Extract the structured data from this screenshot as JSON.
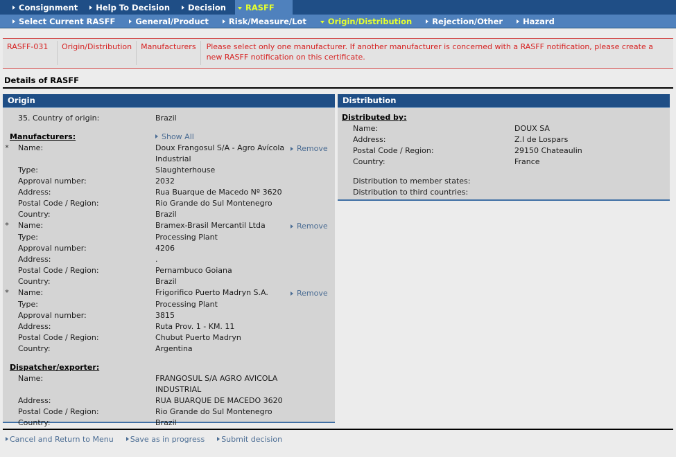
{
  "nav": {
    "primary": [
      {
        "label": "Consignment",
        "icon": "chevron-right-icon",
        "active": false
      },
      {
        "label": "Help To Decision",
        "icon": "chevron-right-icon",
        "active": false
      },
      {
        "label": "Decision",
        "icon": "chevron-right-icon",
        "active": false
      },
      {
        "label": "RASFF",
        "icon": "chevron-down-icon",
        "active": true
      }
    ],
    "secondary": [
      {
        "label": "Select Current RASFF",
        "icon": "chevron-right-icon",
        "active": false
      },
      {
        "label": "General/Product",
        "icon": "chevron-right-icon",
        "active": false
      },
      {
        "label": "Risk/Measure/Lot",
        "icon": "chevron-right-icon",
        "active": false
      },
      {
        "label": "Origin/Distribution",
        "icon": "chevron-down-icon",
        "active": true
      },
      {
        "label": "Rejection/Other",
        "icon": "chevron-right-icon",
        "active": false
      },
      {
        "label": "Hazard",
        "icon": "chevron-right-icon",
        "active": false
      }
    ]
  },
  "message": {
    "code": "RASFF-031",
    "section": "Origin/Distribution",
    "field": "Manufacturers",
    "text": "Please select only one manufacturer. If another manufacturer is concerned with a RASFF notification, please create a new RASFF notification on this certificate.",
    "color": "#d62020"
  },
  "page": {
    "details_title": "Details of RASFF"
  },
  "origin": {
    "panel_title": "Origin",
    "country_of_origin_label": "35. Country of origin:",
    "country_of_origin_value": "Brazil",
    "manufacturers_label": "Manufacturers:",
    "show_all_label": "Show All",
    "remove_label": "Remove",
    "required_marker": "*",
    "field_labels": {
      "name": "Name:",
      "type": "Type:",
      "approval_number": "Approval number:",
      "address": "Address:",
      "postal_code_region": "Postal Code / Region:",
      "country": "Country:"
    },
    "manufacturers": [
      {
        "name": "Doux Frangosul S/A - Agro Avícola Industrial",
        "type": "Slaughterhouse",
        "approval_number": "2032",
        "address": "Rua Buarque de Macedo Nº 3620",
        "postal_code_region": "Rio Grande do Sul Montenegro",
        "country": "Brazil"
      },
      {
        "name": "Bramex-Brasil Mercantil Ltda",
        "type": "Processing Plant",
        "approval_number": "4206",
        "address": ".",
        "postal_code_region": "Pernambuco Goiana",
        "country": "Brazil"
      },
      {
        "name": "Frigorifico Puerto Madryn S.A.",
        "type": "Processing Plant",
        "approval_number": "3815",
        "address": "Ruta Prov. 1 - KM. 11",
        "postal_code_region": "Chubut Puerto Madryn",
        "country": "Argentina"
      }
    ],
    "dispatcher": {
      "heading": "Dispatcher/exporter:",
      "name": "FRANGOSUL S/A AGRO AVICOLA INDUSTRIAL",
      "address": "RUA BUARQUE DE MACEDO 3620",
      "postal_code_region": "Rio Grande do Sul Montenegro",
      "country": "Brazil"
    }
  },
  "distribution": {
    "panel_title": "Distribution",
    "distributed_by_heading": "Distributed by:",
    "field_labels": {
      "name": "Name:",
      "address": "Address:",
      "postal_code_region": "Postal Code / Region:",
      "country": "Country:",
      "member_states": "Distribution to member states:",
      "third_countries": "Distribution to third countries:"
    },
    "distributed_by": {
      "name": "DOUX SA",
      "address": "Z.I de Lospars",
      "postal_code_region": "29150 Chateaulin",
      "country": "France"
    },
    "member_states_value": "",
    "third_countries_value": ""
  },
  "actions": [
    {
      "label": "Cancel and Return to Menu",
      "icon": "chevron-right-icon"
    },
    {
      "label": "Save as in progress",
      "icon": "chevron-right-icon"
    },
    {
      "label": "Submit decision",
      "icon": "chevron-right-icon"
    }
  ]
}
